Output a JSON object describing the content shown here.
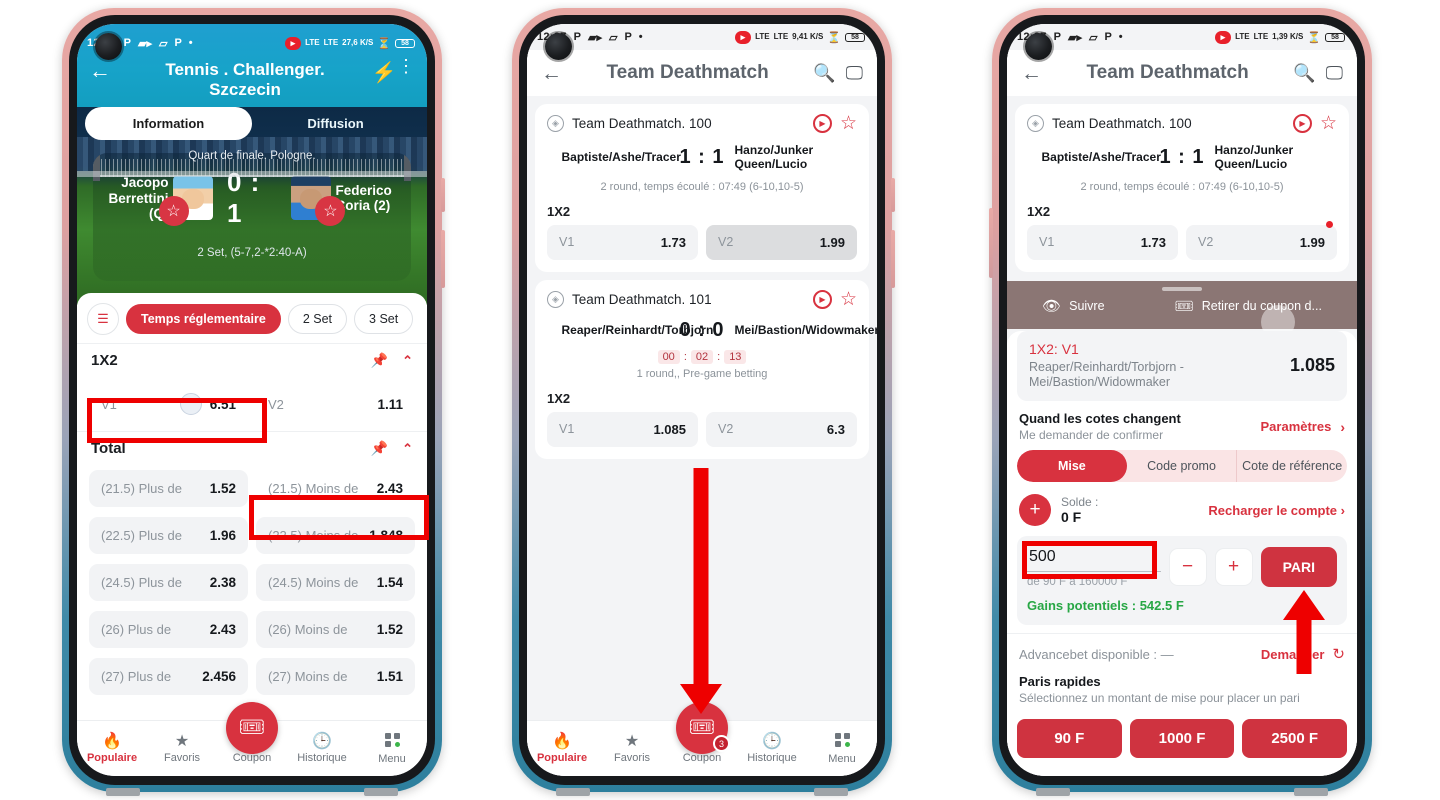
{
  "phone1": {
    "status": {
      "time": "12:27",
      "icons": [
        "P",
        "camcorder-icon",
        "chat-icon",
        "P",
        "dot"
      ],
      "rec": "REC",
      "net1": "LTE",
      "net2": "LTE",
      "speed": "27,6 K/S",
      "battery": "58"
    },
    "header": {
      "title_line1": "Tennis . Challenger.",
      "title_line2": "Szczecin",
      "back": "back-arrow",
      "bolt": "lightning-icon",
      "menu": "kebab-icon"
    },
    "tabs": [
      {
        "label": "Information",
        "active": true
      },
      {
        "label": "Diffusion",
        "active": false
      }
    ],
    "match": {
      "round": "Quart de finale. Pologne.",
      "player_left": "Jacopo Berrettini (Q)",
      "player_right": "Federico Coria (2)",
      "score": "0 : 1",
      "set_info": "2 Set, (5-7,2-*2:40-A)"
    },
    "filters": [
      {
        "label": "Temps réglementaire",
        "active": true
      },
      {
        "label": "2 Set",
        "active": false
      },
      {
        "label": "3 Set",
        "active": false
      }
    ],
    "markets": [
      {
        "title": "1X2",
        "rows": [
          [
            {
              "label": "V1",
              "value": "6.51",
              "highlighted": true
            },
            {
              "label": "V2",
              "value": "1.11",
              "highlighted": false
            }
          ]
        ]
      },
      {
        "title": "Total",
        "rows": [
          [
            {
              "label": "(21.5) Plus de",
              "value": "1.52"
            },
            {
              "label": "(21.5) Moins de",
              "value": "2.43",
              "highlighted": true
            }
          ],
          [
            {
              "label": "(22.5) Plus de",
              "value": "1.96"
            },
            {
              "label": "(22.5) Moins de",
              "value": "1.848"
            }
          ],
          [
            {
              "label": "(24.5) Plus de",
              "value": "2.38"
            },
            {
              "label": "(24.5) Moins de",
              "value": "1.54"
            }
          ],
          [
            {
              "label": "(26) Plus de",
              "value": "2.43"
            },
            {
              "label": "(26) Moins de",
              "value": "1.52"
            }
          ],
          [
            {
              "label": "(27) Plus de",
              "value": "2.456"
            },
            {
              "label": "(27) Moins de",
              "value": "1.51"
            }
          ]
        ]
      }
    ],
    "nav": [
      {
        "label": "Populaire",
        "icon": "flame-icon",
        "active": true
      },
      {
        "label": "Favoris",
        "icon": "star-icon",
        "active": false
      },
      {
        "label": "Coupon",
        "icon": "ticket-icon",
        "active": false
      },
      {
        "label": "Historique",
        "icon": "clock-icon",
        "active": false
      },
      {
        "label": "Menu",
        "icon": "grid-icon",
        "active": false
      }
    ],
    "coupon_badge": ""
  },
  "phone2": {
    "status": {
      "time": "12:27",
      "speed": "9,41 K/S",
      "battery": "58"
    },
    "header": {
      "title": "Team Deathmatch",
      "back": "back-arrow",
      "search": "search-icon",
      "video": "video-icon"
    },
    "events": [
      {
        "name": "Team Deathmatch. 100",
        "team_left": "Baptiste/Ashe/Tracer",
        "team_right": "Hanzo/Junker Queen/Lucio",
        "score": "1 : 1",
        "meta": "2 round, temps écoulé : 07:49 (6-10,10-5)",
        "timer": null,
        "market": "1X2",
        "odds": [
          {
            "label": "V1",
            "value": "1.73",
            "shaded": false
          },
          {
            "label": "V2",
            "value": "1.99",
            "shaded": true
          }
        ]
      },
      {
        "name": "Team Deathmatch. 101",
        "team_left": "Reaper/Reinhardt/Torbjorn",
        "team_right": "Mei/Bastion/Widowmaker",
        "score": "0 : 0",
        "meta": "1 round,, Pre-game betting",
        "timer": [
          "00",
          "02",
          "13"
        ],
        "market": "1X2",
        "odds": [
          {
            "label": "V1",
            "value": "1.085",
            "shaded": false
          },
          {
            "label": "V2",
            "value": "6.3",
            "shaded": false
          }
        ]
      }
    ],
    "nav": [
      {
        "label": "Populaire",
        "icon": "flame-icon",
        "active": true
      },
      {
        "label": "Favoris",
        "icon": "star-icon",
        "active": false
      },
      {
        "label": "Coupon",
        "icon": "ticket-icon",
        "active": false
      },
      {
        "label": "Historique",
        "icon": "clock-icon",
        "active": false
      },
      {
        "label": "Menu",
        "icon": "grid-icon",
        "active": false
      }
    ],
    "coupon_badge": "3"
  },
  "phone3": {
    "status": {
      "time": "12:27",
      "speed": "1,39 K/S",
      "battery": "58"
    },
    "header": {
      "title": "Team Deathmatch",
      "search": "search-icon",
      "video": "video-icon"
    },
    "event": {
      "name": "Team Deathmatch. 100",
      "team_left": "Baptiste/Ashe/Tracer",
      "team_right": "Hanzo/Junker Queen/Lucio",
      "score": "1 : 1",
      "meta": "2 round, temps écoulé : 07:49 (6-10,10-5)",
      "market": "1X2",
      "odds": [
        {
          "label": "V1",
          "value": "1.73"
        },
        {
          "label": "V2",
          "value": "1.99"
        }
      ]
    },
    "slip": {
      "action_follow": "Suivre",
      "action_remove": "Retirer du coupon d...",
      "selection_market": "1X2: V1",
      "selection_event": "Reaper/Reinhardt/Torbjorn - Mei/Bastion/Widowmaker",
      "selection_odd": "1.085",
      "odds_change_title": "Quand les cotes changent",
      "odds_change_sub": "Me demander de confirmer",
      "settings_label": "Paramètres",
      "segments": [
        {
          "label": "Mise",
          "active": true
        },
        {
          "label": "Code promo",
          "active": false
        },
        {
          "label": "Cote de référence",
          "active": false
        }
      ],
      "balance_label": "Solde :",
      "balance_value": "0 F",
      "recharge_label": "Recharger le compte",
      "stake_value": "500",
      "stake_hint": "de 90 F à 160000 F",
      "minus": "−",
      "plus": "+",
      "bet_button": "PARI",
      "gains_label": "Gains potentiels :",
      "gains_value": "542.5 F",
      "advancebet_label": "Advancebet disponible : —",
      "advancebet_action": "Demander",
      "quick_title": "Paris rapides",
      "quick_sub": "Sélectionnez un montant de mise pour placer un pari",
      "quick_amounts": [
        "90 F",
        "1000 F",
        "2500 F"
      ]
    }
  },
  "colors": {
    "accent": "#d8323f",
    "annotation": "#ee0000",
    "green": "#28a745",
    "header_blue": "#17a3c9",
    "slip_brown": "#8b7674"
  }
}
